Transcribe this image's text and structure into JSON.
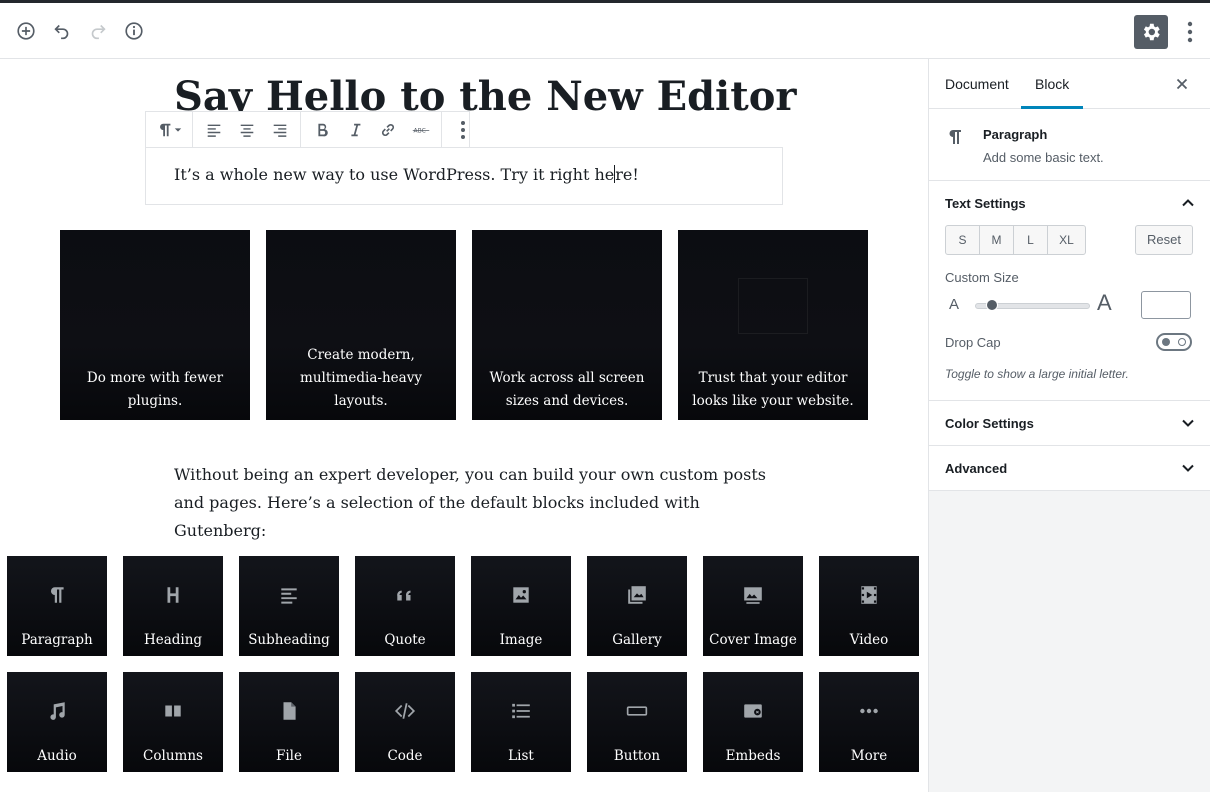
{
  "toolbar": {
    "icons": [
      "add-block-icon",
      "undo-icon",
      "redo-icon",
      "info-icon",
      "gear-icon",
      "more-vertical-icon"
    ]
  },
  "editor": {
    "post_title": "Say Hello to the New Editor",
    "paragraph_text_before_caret": "It’s a whole new way to use WordPress. Try it right he",
    "paragraph_text_after_caret": "re!",
    "gallery": [
      {
        "caption": "Do more with fewer plugins."
      },
      {
        "caption": "Create modern, multimedia-heavy layouts."
      },
      {
        "caption": "Work across all screen sizes and devices."
      },
      {
        "caption": "Trust that your editor looks like your website."
      }
    ],
    "intro_text": "Without being an expert developer, you can build your own custom posts and pages. Here’s a selection of the default blocks included with Gutenberg:",
    "blocks": [
      {
        "label": "Paragraph",
        "icon": "paragraph-icon"
      },
      {
        "label": "Heading",
        "icon": "heading-icon"
      },
      {
        "label": "Subheading",
        "icon": "subheading-icon"
      },
      {
        "label": "Quote",
        "icon": "quote-icon"
      },
      {
        "label": "Image",
        "icon": "image-icon"
      },
      {
        "label": "Gallery",
        "icon": "gallery-icon"
      },
      {
        "label": "Cover Image",
        "icon": "cover-image-icon"
      },
      {
        "label": "Video",
        "icon": "video-icon"
      },
      {
        "label": "Audio",
        "icon": "audio-icon"
      },
      {
        "label": "Columns",
        "icon": "columns-icon"
      },
      {
        "label": "File",
        "icon": "file-icon"
      },
      {
        "label": "Code",
        "icon": "code-icon"
      },
      {
        "label": "List",
        "icon": "list-icon"
      },
      {
        "label": "Button",
        "icon": "button-icon"
      },
      {
        "label": "Embeds",
        "icon": "embeds-icon"
      },
      {
        "label": "More",
        "icon": "more-horizontal-icon"
      }
    ]
  },
  "sidebar": {
    "tabs": [
      {
        "label": "Document",
        "active": false
      },
      {
        "label": "Block",
        "active": true
      }
    ],
    "block_name": "Paragraph",
    "block_description": "Add some basic text.",
    "text_settings": {
      "title": "Text Settings",
      "sizes": [
        "S",
        "M",
        "L",
        "XL"
      ],
      "reset_label": "Reset",
      "custom_size_label": "Custom Size",
      "a_small": "A",
      "a_large": "A",
      "drop_cap_label": "Drop Cap",
      "drop_cap_enabled": false,
      "drop_cap_help": "Toggle to show a large initial letter."
    },
    "color_settings_title": "Color Settings",
    "advanced_title": "Advanced"
  },
  "colors": {
    "accent": "#0085ba",
    "dark_tile": "#0c0d12",
    "settings_button": "#555d66"
  }
}
